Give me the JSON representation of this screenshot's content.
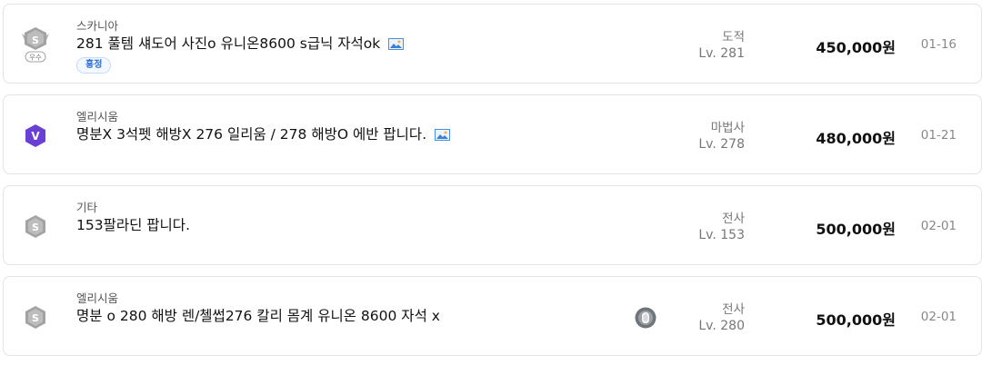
{
  "listings": [
    {
      "server": "스카니아",
      "title": "281 풀템 섀도어 사진o 유니온8600 s급닉 자석ok",
      "badge": "우수",
      "badge_letter": "S",
      "tag": "흥정",
      "job": "도적",
      "level": "Lv. 281",
      "price": "450,000원",
      "date": "01-16"
    },
    {
      "server": "엘리시움",
      "title": "명분X 3석펫 해방X 276 일리움 / 278 해방O 에반 팝니다.",
      "badge_letter": "V",
      "job": "마법사",
      "level": "Lv. 278",
      "price": "480,000원",
      "date": "01-21"
    },
    {
      "server": "기타",
      "title": "153팔라딘 팝니다.",
      "badge_letter": "S",
      "job": "전사",
      "level": "Lv. 153",
      "price": "500,000원",
      "date": "02-01"
    },
    {
      "server": "엘리시움",
      "title": "명분 o 280 해방 렌/첼썹276 칼리 몸계 유니온 8600 자석 x",
      "badge_letter": "S",
      "job": "전사",
      "level": "Lv. 280",
      "price": "500,000원",
      "date": "02-01"
    }
  ],
  "colors": {
    "accent_purple": "#6a3fd6",
    "badge_gray": "#9a9a9a",
    "tag_blue": "#2d6fd1"
  },
  "icons": {
    "image_attachment": "image-icon",
    "grade_s": "s-grade-shield-icon",
    "grade_v": "v-grade-hexagon-icon",
    "seller_avatar": "avatar-icon"
  }
}
